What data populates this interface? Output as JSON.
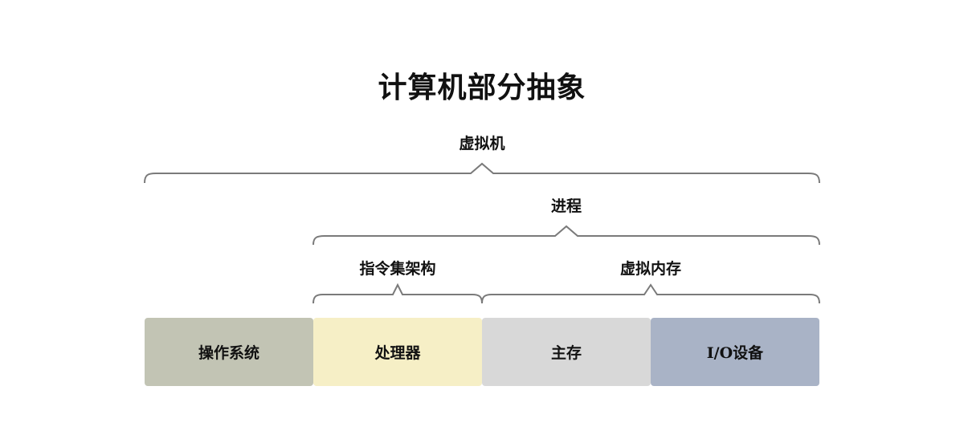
{
  "title": "计算机部分抽象",
  "brackets": {
    "virtual_machine": "虚拟机",
    "process": "进程",
    "isa": "指令集架构",
    "virtual_memory": "虚拟内存"
  },
  "blocks": [
    {
      "label": "操作系统",
      "color": "#c2c4b4"
    },
    {
      "label": "处理器",
      "color": "#f6efc6"
    },
    {
      "label": "主存",
      "color": "#d8d8d8"
    },
    {
      "label": "I/O设备",
      "color": "#a9b3c6"
    }
  ],
  "bracket_color": "#7a7a7a"
}
